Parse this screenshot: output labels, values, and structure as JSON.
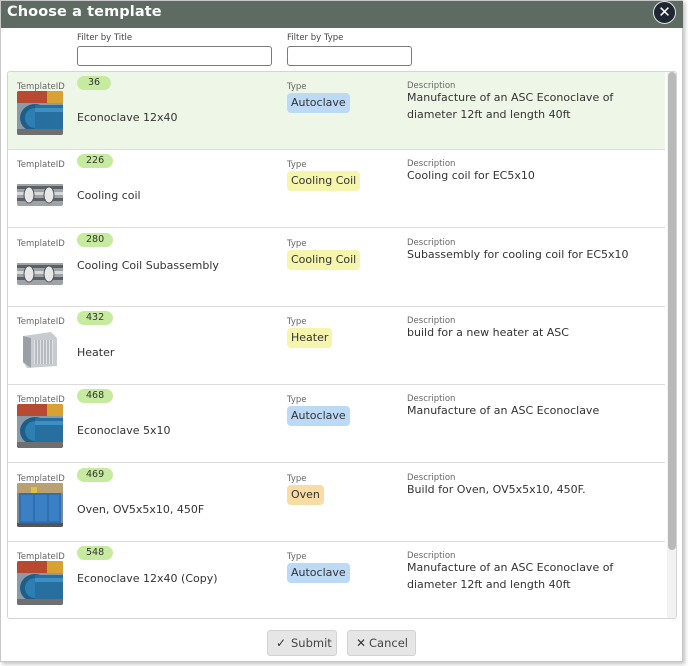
{
  "dialog": {
    "title": "Choose a template",
    "close_icon": "close-icon"
  },
  "filters": {
    "title_label": "Filter by Title",
    "title_value": "",
    "type_label": "Filter by Type",
    "type_value": ""
  },
  "labels": {
    "template_id": "TemplateID",
    "type": "Type",
    "description": "Description"
  },
  "rows": [
    {
      "id": "36",
      "title": "Econoclave 12x40",
      "type": "Autoclave",
      "type_color": "#bcd9f6",
      "description": "Manufacture of an ASC Econoclave of diameter 12ft and length 40ft",
      "thumb": "autoclave",
      "selected": true
    },
    {
      "id": "226",
      "title": "Cooling coil",
      "type": "Cooling Coil",
      "type_color": "#f6f5ad",
      "description": "Cooling coil for EC5x10",
      "thumb": "coil"
    },
    {
      "id": "280",
      "title": "Cooling Coil Subassembly",
      "type": "Cooling Coil",
      "type_color": "#f6f5ad",
      "description": "Subassembly for cooling coil for EC5x10",
      "thumb": "coil"
    },
    {
      "id": "432",
      "title": "Heater",
      "type": "Heater",
      "type_color": "#f6f5ad",
      "description": "build for a new heater at ASC",
      "thumb": "heater"
    },
    {
      "id": "468",
      "title": "Econoclave 5x10",
      "type": "Autoclave",
      "type_color": "#bcd9f6",
      "description": "Manufacture of an ASC Econoclave",
      "thumb": "autoclave"
    },
    {
      "id": "469",
      "title": "Oven, OV5x5x10, 450F",
      "type": "Oven",
      "type_color": "#f8dca4",
      "description": "Build for Oven, OV5x5x10, 450F.",
      "thumb": "oven"
    },
    {
      "id": "548",
      "title": "Econoclave 12x40 (Copy)",
      "type": "Autoclave",
      "type_color": "#bcd9f6",
      "description": "Manufacture of an ASC Econoclave of diameter 12ft and length 40ft",
      "thumb": "autoclave"
    }
  ],
  "footer": {
    "submit_label": "Submit",
    "submit_icon": "check-icon",
    "cancel_label": "Cancel",
    "cancel_icon": "x-icon"
  },
  "colors": {
    "titlebar": "#5d6b62",
    "selected_row": "#eef7e7",
    "id_badge": "#c6eb9e"
  }
}
